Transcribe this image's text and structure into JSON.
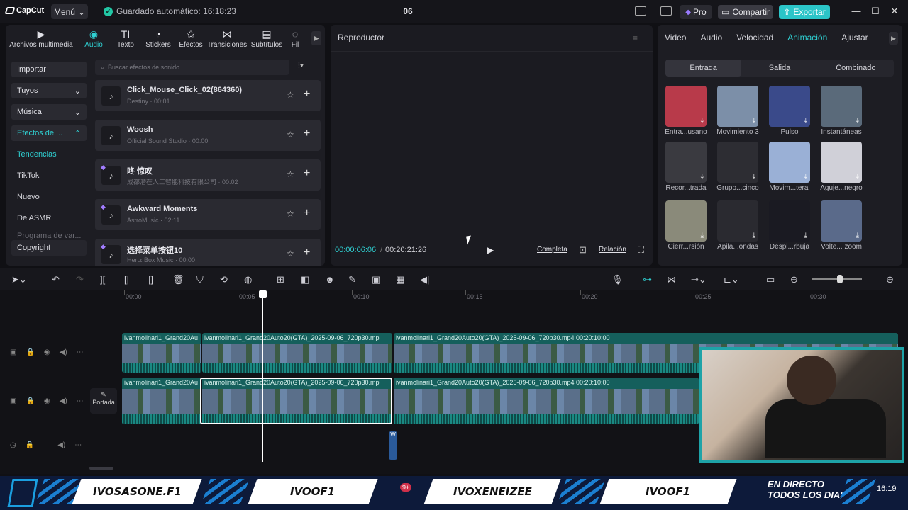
{
  "titlebar": {
    "app": "CapCut",
    "menu_label": "Menú",
    "autosave": "Guardado automático: 16:18:23",
    "project": "06",
    "pro_label": "Pro",
    "share_label": "Compartir",
    "export_label": "Exportar"
  },
  "leftpanel": {
    "tabs": [
      {
        "label": "Archivos multimedia",
        "icon": "media-icon"
      },
      {
        "label": "Audio",
        "icon": "audio-icon"
      },
      {
        "label": "Texto",
        "icon": "text-icon"
      },
      {
        "label": "Stickers",
        "icon": "sticker-icon"
      },
      {
        "label": "Efectos",
        "icon": "effects-icon"
      },
      {
        "label": "Transiciones",
        "icon": "transitions-icon"
      },
      {
        "label": "Subtítulos",
        "icon": "subtitles-icon"
      },
      {
        "label": "Fil",
        "icon": "filter-icon"
      }
    ],
    "nav": {
      "importar": "Importar",
      "tuyos": "Tuyos",
      "musica": "Música",
      "efectos": "Efectos de ...",
      "tendencias": "Tendencias",
      "tiktok": "TikTok",
      "nuevo": "Nuevo",
      "asmr": "De ASMR",
      "programa": "Programa de var...",
      "copyright": "Copyright"
    },
    "search_placeholder": "Buscar efectos de sonido",
    "sounds": [
      {
        "title": "Click_Mouse_Click_02(864360)",
        "sub": "Destiny · 00:01",
        "pro": false
      },
      {
        "title": "Woosh",
        "sub": "Official Sound Studio · 00:00",
        "pro": false
      },
      {
        "title": "咚 惊叹",
        "sub": "成都潜在人工智能科技有限公司 · 00:02",
        "pro": true
      },
      {
        "title": "Awkward Moments",
        "sub": "AstroMusic · 02:11",
        "pro": true
      },
      {
        "title": "选择菜单按钮10",
        "sub": "Hertz Box Music · 00:00",
        "pro": true
      }
    ]
  },
  "player": {
    "title": "Reproductor",
    "current_time": "00:00:06:06",
    "total_time": "00:20:21:26",
    "completa": "Completa",
    "relacion": "Relación"
  },
  "rightpanel": {
    "tabs": [
      "Video",
      "Audio",
      "Velocidad",
      "Animación",
      "Ajustar"
    ],
    "active_tab": "Animación",
    "subtabs": [
      "Entrada",
      "Salida",
      "Combinado"
    ],
    "animations": [
      {
        "label": "Entra...usano",
        "color": "#b83a4a"
      },
      {
        "label": "Movimiento 3",
        "color": "#7c8fa8"
      },
      {
        "label": "Pulso",
        "color": "#3a4a8a"
      },
      {
        "label": "Instantáneas",
        "color": "#5a6a7a"
      },
      {
        "label": "Recor...trada",
        "color": "#3a3a40"
      },
      {
        "label": "Grupo...cinco",
        "color": "#2d2d33"
      },
      {
        "label": "Movim...teral",
        "color": "#9ab0d6"
      },
      {
        "label": "Aguje...negro",
        "color": "#d0d0d8"
      },
      {
        "label": "Cierr...rsión",
        "color": "#8a8a7a"
      },
      {
        "label": "Apila...ondas",
        "color": "#2a2a30"
      },
      {
        "label": "Despl...rbuja",
        "color": "#1a1a22"
      },
      {
        "label": "Volte... zoom",
        "color": "#5a6a8a"
      }
    ]
  },
  "timeline": {
    "ruler": [
      "00:00",
      "00:05",
      "00:10",
      "00:15",
      "00:20",
      "00:25",
      "00:30"
    ],
    "clip_top_a": "ivanmolinari1_Grand20Au",
    "clip_top_b": "ivanmolinari1_Grand20Auto20(GTA)_2025-09-06_720p30.mp",
    "clip_top_c": "ivanmolinari1_Grand20Auto20(GTA)_2025-09-06_720p30.mp4   00:20:10:00",
    "clip_bot_a": "ivanmolinari1_Grand20Au",
    "clip_bot_b": "ivanmolinari1_Grand20Auto20(GTA)_2025-09-06_720p30.mp",
    "clip_bot_c": "ivanmolinari1_Grand20Auto20(GTA)_2025-09-06_720p30.mp4   00:20:10:00",
    "portada": "Portada",
    "audio_clip": "W"
  },
  "banner": {
    "slot1": "IVOSASONE.F1",
    "slot2": "IVOOF1",
    "slot3": "IVOXENEIZEE",
    "slot4": "IVOOF1",
    "badge": "9+",
    "tagline": "EN DIRECTO TODOS LOS DIAS",
    "time": "16:19"
  }
}
